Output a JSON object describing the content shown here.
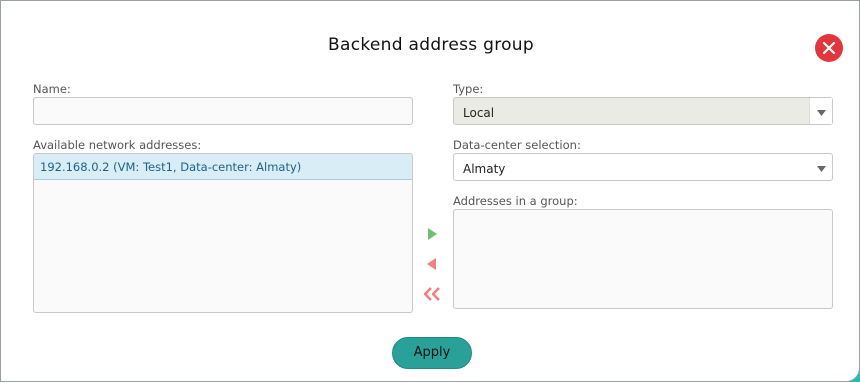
{
  "dialog": {
    "title": "Backend address group",
    "close_icon": "close-icon",
    "apply_label": "Apply"
  },
  "form": {
    "name_label": "Name:",
    "name_value": "",
    "type_label": "Type:",
    "type_value": "Local",
    "available_label": "Available network addresses:",
    "available_items": [
      "192.168.0.2 (VM: Test1, Data-center: Almaty)"
    ],
    "datacenter_label": "Data-center selection:",
    "datacenter_value": "Almaty",
    "group_label": "Addresses in a group:",
    "group_items": []
  },
  "transfer": {
    "add_icon": "triangle-right-icon",
    "remove_icon": "triangle-left-icon",
    "remove_all_icon": "double-chevron-left-icon"
  },
  "colors": {
    "frame": "#23bdb4",
    "close": "#e0363c",
    "apply": "#2aa198",
    "selected_row": "#d9edf7",
    "add_arrow": "#6dc06d",
    "remove_arrow": "#f08080"
  }
}
